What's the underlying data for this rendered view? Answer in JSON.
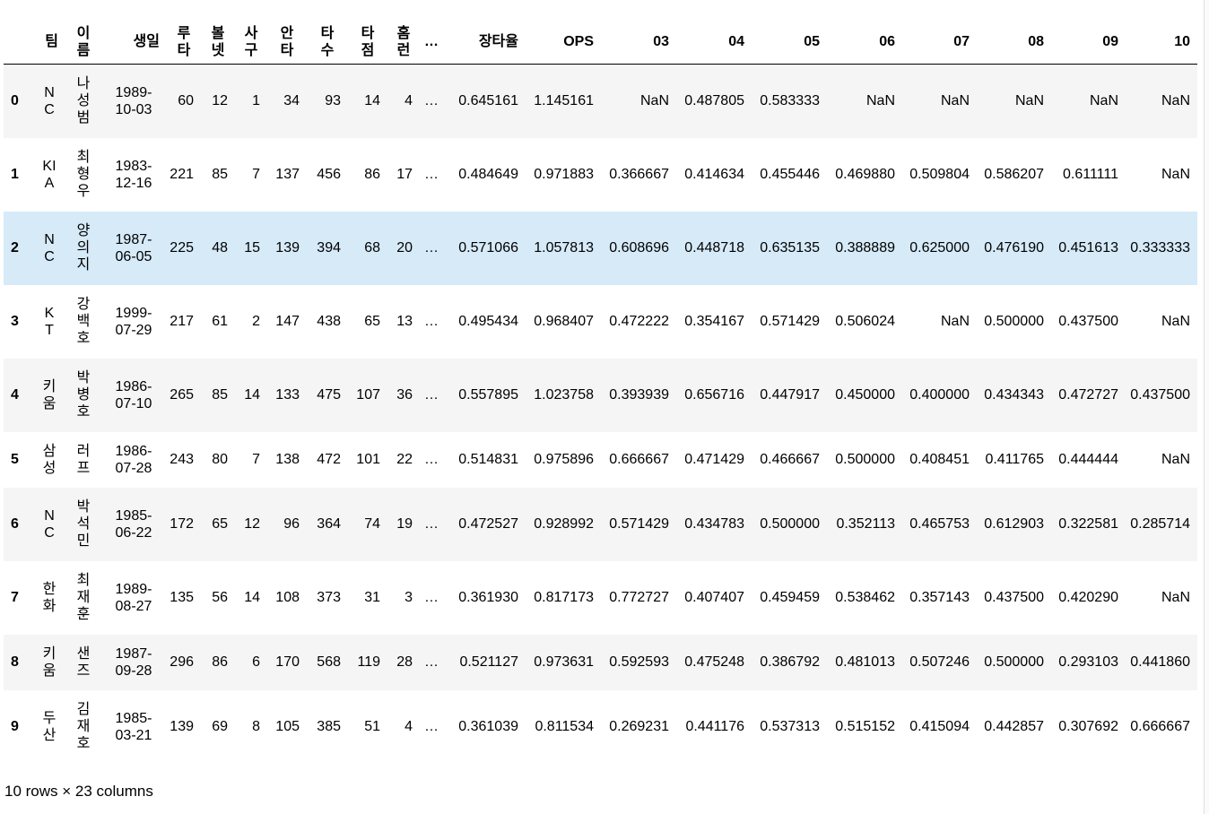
{
  "table": {
    "columns": [
      "",
      "팀",
      "이름",
      "생일",
      "루타",
      "볼넷",
      "사구",
      "안타",
      "타수",
      "타점",
      "홈런",
      "…",
      "장타율",
      "OPS",
      "03",
      "04",
      "05",
      "06",
      "07",
      "08",
      "09",
      "10"
    ],
    "rows": [
      {
        "idx": "0",
        "team": "NC",
        "name": "나성범",
        "birth": "1989-10-03",
        "v": [
          "60",
          "12",
          "1",
          "34",
          "93",
          "14",
          "4"
        ],
        "dots": "…",
        "slg": "0.645161",
        "ops": "1.145161",
        "yrs": [
          "NaN",
          "0.487805",
          "0.583333",
          "NaN",
          "NaN",
          "NaN",
          "NaN",
          "NaN"
        ]
      },
      {
        "idx": "1",
        "team": "KIA",
        "name": "최형우",
        "birth": "1983-12-16",
        "v": [
          "221",
          "85",
          "7",
          "137",
          "456",
          "86",
          "17"
        ],
        "dots": "…",
        "slg": "0.484649",
        "ops": "0.971883",
        "yrs": [
          "0.366667",
          "0.414634",
          "0.455446",
          "0.469880",
          "0.509804",
          "0.586207",
          "0.611111",
          "NaN"
        ]
      },
      {
        "idx": "2",
        "team": "NC",
        "name": "양의지",
        "birth": "1987-06-05",
        "v": [
          "225",
          "48",
          "15",
          "139",
          "394",
          "68",
          "20"
        ],
        "dots": "…",
        "slg": "0.571066",
        "ops": "1.057813",
        "yrs": [
          "0.608696",
          "0.448718",
          "0.635135",
          "0.388889",
          "0.625000",
          "0.476190",
          "0.451613",
          "0.333333"
        ]
      },
      {
        "idx": "3",
        "team": "KT",
        "name": "강백호",
        "birth": "1999-07-29",
        "v": [
          "217",
          "61",
          "2",
          "147",
          "438",
          "65",
          "13"
        ],
        "dots": "…",
        "slg": "0.495434",
        "ops": "0.968407",
        "yrs": [
          "0.472222",
          "0.354167",
          "0.571429",
          "0.506024",
          "NaN",
          "0.500000",
          "0.437500",
          "NaN"
        ]
      },
      {
        "idx": "4",
        "team": "키움",
        "name": "박병호",
        "birth": "1986-07-10",
        "v": [
          "265",
          "85",
          "14",
          "133",
          "475",
          "107",
          "36"
        ],
        "dots": "…",
        "slg": "0.557895",
        "ops": "1.023758",
        "yrs": [
          "0.393939",
          "0.656716",
          "0.447917",
          "0.450000",
          "0.400000",
          "0.434343",
          "0.472727",
          "0.437500"
        ]
      },
      {
        "idx": "5",
        "team": "삼성",
        "name": "러프",
        "birth": "1986-07-28",
        "v": [
          "243",
          "80",
          "7",
          "138",
          "472",
          "101",
          "22"
        ],
        "dots": "…",
        "slg": "0.514831",
        "ops": "0.975896",
        "yrs": [
          "0.666667",
          "0.471429",
          "0.466667",
          "0.500000",
          "0.408451",
          "0.411765",
          "0.444444",
          "NaN"
        ]
      },
      {
        "idx": "6",
        "team": "NC",
        "name": "박석민",
        "birth": "1985-06-22",
        "v": [
          "172",
          "65",
          "12",
          "96",
          "364",
          "74",
          "19"
        ],
        "dots": "…",
        "slg": "0.472527",
        "ops": "0.928992",
        "yrs": [
          "0.571429",
          "0.434783",
          "0.500000",
          "0.352113",
          "0.465753",
          "0.612903",
          "0.322581",
          "0.285714"
        ]
      },
      {
        "idx": "7",
        "team": "한화",
        "name": "최재훈",
        "birth": "1989-08-27",
        "v": [
          "135",
          "56",
          "14",
          "108",
          "373",
          "31",
          "3"
        ],
        "dots": "…",
        "slg": "0.361930",
        "ops": "0.817173",
        "yrs": [
          "0.772727",
          "0.407407",
          "0.459459",
          "0.538462",
          "0.357143",
          "0.437500",
          "0.420290",
          "NaN"
        ]
      },
      {
        "idx": "8",
        "team": "키움",
        "name": "샌즈",
        "birth": "1987-09-28",
        "v": [
          "296",
          "86",
          "6",
          "170",
          "568",
          "119",
          "28"
        ],
        "dots": "…",
        "slg": "0.521127",
        "ops": "0.973631",
        "yrs": [
          "0.592593",
          "0.475248",
          "0.386792",
          "0.481013",
          "0.507246",
          "0.500000",
          "0.293103",
          "0.441860"
        ]
      },
      {
        "idx": "9",
        "team": "두산",
        "name": "김재호",
        "birth": "1985-03-21",
        "v": [
          "139",
          "69",
          "8",
          "105",
          "385",
          "51",
          "4"
        ],
        "dots": "…",
        "slg": "0.361039",
        "ops": "0.811534",
        "yrs": [
          "0.269231",
          "0.441176",
          "0.537313",
          "0.515152",
          "0.415094",
          "0.442857",
          "0.307692",
          "0.666667"
        ]
      }
    ],
    "highlight_color": "#d6eaf8",
    "stripe_color": "#f5f5f5"
  },
  "footer": {
    "shape_text": "10 rows × 23 columns"
  }
}
